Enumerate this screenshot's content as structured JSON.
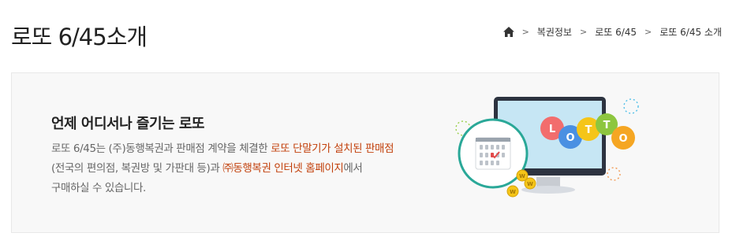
{
  "page": {
    "title": "로또 6/45소개"
  },
  "breadcrumb": {
    "home_icon": "home-icon",
    "separator_icon": "chevron-right-icon",
    "items": [
      "복권정보",
      "로또 6/45",
      "로또 6/45 소개"
    ]
  },
  "intro": {
    "heading": "언제 어디서나 즐기는 로또",
    "desc_1": "로또 6/45는 (주)동행복권과 판매점 계약을 체결한 ",
    "desc_highlight_1": "로또 단말기가 설치된 판매점",
    "desc_2": "(전국의 편의점, 복권방 및 가판대 등)과 ",
    "desc_highlight_2": "㈜동행복권 인터넷 홈페이지",
    "desc_3": "에서",
    "desc_4": "구매하실 수 있습니다.",
    "highlight_color": "#c2410c"
  },
  "illustration": {
    "ball_letters": [
      "L",
      "O",
      "T",
      "T",
      "O"
    ],
    "ball_colors": [
      "#f26d6d",
      "#4a90e2",
      "#f5c518",
      "#8dc63f",
      "#f5a623"
    ],
    "coin_symbol": "W"
  }
}
